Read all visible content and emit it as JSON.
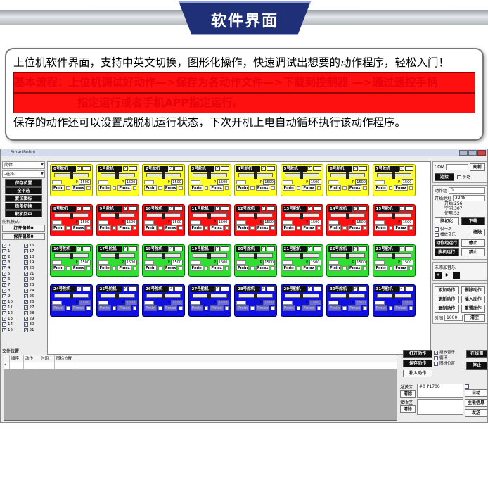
{
  "banner": {
    "title": "软件界面"
  },
  "intro": {
    "line1": "上位机软件界面，支持中英文切换，图形化操作，快速调试出想要的动作程序，轻松入门！",
    "line2": "基本流程：上位机调试好动作—>保存为各动作文件—>下载到控制器 —>通过遥控手柄",
    "line3": "指定运行或者手机APP指定运行。",
    "line4": "保存的动作还可以设置成脱机运行状态，下次开机上电自动循环执行该动作程序。"
  },
  "window": {
    "title": "SmartRobot"
  },
  "left": {
    "lang_select": "简体",
    "choose_select": "-选择-",
    "buttons": [
      "保存位置",
      "全不选",
      "复位图标",
      "极限切换",
      "舵机回中"
    ],
    "label_servo_mode": "舵机模式:",
    "open_offset": "打开偏差0",
    "save_offset": "保存偏差0",
    "checks_left": [
      "0",
      "1",
      "2",
      "3",
      "4",
      "5",
      "6",
      "7",
      "8",
      "9",
      "10",
      "11",
      "12",
      "13",
      "14",
      "15"
    ],
    "checks_right": [
      "16",
      "17",
      "18",
      "19",
      "20",
      "21",
      "22",
      "23",
      "24",
      "25",
      "26",
      "27",
      "28",
      "29",
      "30",
      "31"
    ]
  },
  "servos": {
    "pwm_value": "1500",
    "pmin_label": "Pmin",
    "pmax_label": "Pmax",
    "p_label": "P",
    "row_labels": [
      [
        "0号舵机",
        "1号舵机",
        "2号舵机",
        "3号舵机",
        "4号舵机",
        "5号舵机",
        "6号舵机",
        "7号舵机"
      ],
      [
        "8号舵机",
        "9号舵机",
        "10号舵机",
        "11号舵机",
        "12号舵机",
        "13号舵机",
        "14号舵机",
        "15号舵机"
      ],
      [
        "16号舵机",
        "17号舵机",
        "18号舵机",
        "19号舵机",
        "20号舵机",
        "21号舵机",
        "22号舵机",
        "23号舵机"
      ],
      [
        "24号舵机",
        "25号舵机",
        "26号舵机",
        "27号舵机",
        "28号舵机",
        "29号舵机",
        "30号舵机",
        "31号舵机"
      ]
    ],
    "row_colors": [
      "#ffff20",
      "#ff1010",
      "#30e030",
      "#1010e0"
    ]
  },
  "right": {
    "com_label": "COM",
    "refresh": "刷新",
    "connect": "连接",
    "multi": "多路",
    "action_group_label": "动作组",
    "action_group_value": "0",
    "start_addr_label": "开始地址",
    "start_addr_value": "3248",
    "open_label": "开始",
    "open_value": "256",
    "space_label": "空闲",
    "space_value": "307",
    "used_label": "使用",
    "used_value": "52",
    "init": "脑初化",
    "download": "下载",
    "once": "仅一次",
    "play_music": "播放音乐",
    "erase": "擦除",
    "run_group": "动作组运行",
    "stop": "停止",
    "offline_run": "脱机运行",
    "disable": "禁止",
    "music_label": "未添加音乐",
    "add_action": "添加动作",
    "delete_action": "删除动作",
    "update_action": "更新动作",
    "insert_action": "插入动作",
    "copy_action": "复制动作",
    "reset_all": "重置动作",
    "time_label": "时间",
    "time_value": "1000",
    "clear": "清空",
    "online": "在线调",
    "stop2": "停止"
  },
  "bottom": {
    "file_pos_label": "文件位置",
    "table_headers": [
      "顺序",
      "动作",
      "时间",
      "图标位置"
    ],
    "open_action": "打开动作",
    "save_action": "保存动作",
    "add_action": "补入动作",
    "play_music": "播放音乐",
    "loop": "循环",
    "icon_pos": "图标位置",
    "send_label": "发送区",
    "send_value": "#0 P1700",
    "clear": "清除",
    "recv_label": "接收区",
    "clear2": "清除",
    "main_info": "主板信息",
    "send_btn": "发送",
    "hex_label": "16进",
    "auto_label": "自动"
  }
}
